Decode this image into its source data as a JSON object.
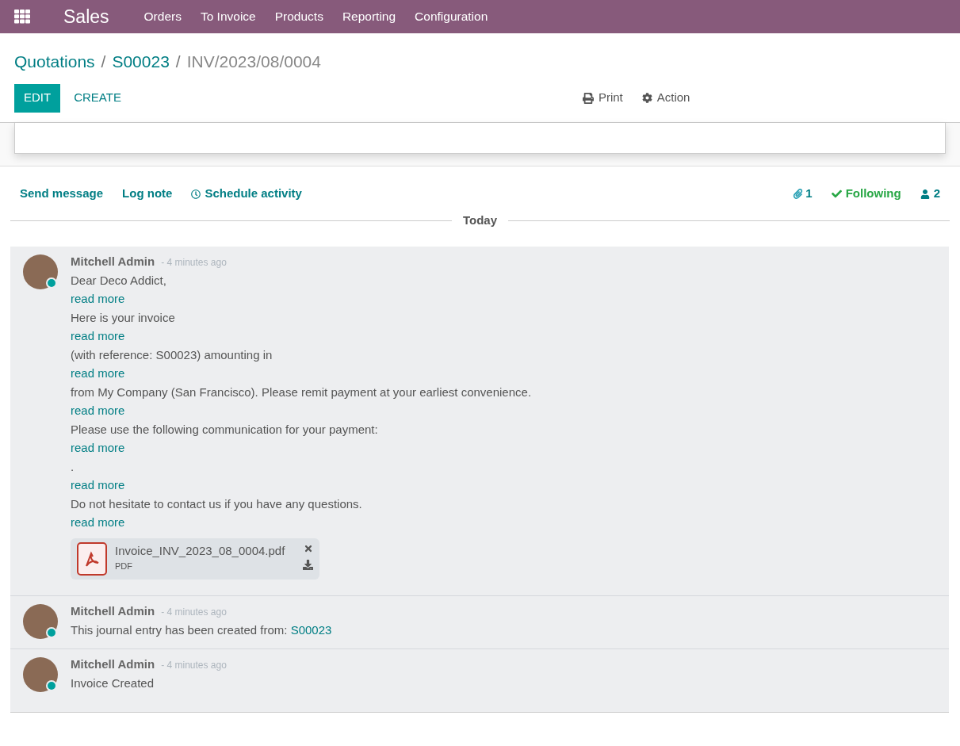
{
  "navbar": {
    "app_name": "Sales",
    "menu": [
      "Orders",
      "To Invoice",
      "Products",
      "Reporting",
      "Configuration"
    ]
  },
  "breadcrumb": {
    "links": [
      "Quotations",
      "S00023"
    ],
    "current": "INV/2023/08/0004",
    "separator": "/"
  },
  "buttons": {
    "edit": "EDIT",
    "create": "CREATE",
    "print": "Print",
    "action": "Action"
  },
  "chatter": {
    "actions": [
      {
        "label": "Send message",
        "kind": "plain"
      },
      {
        "label": "Log note",
        "kind": "plain"
      },
      {
        "label": "Schedule activity",
        "kind": "clock"
      }
    ],
    "attachments_count": "1",
    "following": {
      "label": "Following",
      "on": true
    },
    "followers_count": "2"
  },
  "date_separator": "Today",
  "messages": [
    {
      "author": "Mitchell Admin",
      "time": "- 4 minutes ago",
      "online": true,
      "lines": [
        [
          {
            "kind": "text",
            "text": "Dear Deco Addict,"
          }
        ],
        [
          {
            "kind": "link",
            "text": "read more"
          }
        ],
        [
          {
            "kind": "text",
            "text": "Here is your invoice"
          }
        ],
        [
          {
            "kind": "link",
            "text": "read more"
          }
        ],
        [
          {
            "kind": "text",
            "text": "(with reference: S00023) amounting in"
          }
        ],
        [
          {
            "kind": "link",
            "text": "read more"
          }
        ],
        [
          {
            "kind": "text",
            "text": "from My Company (San Francisco). Please remit payment at your earliest convenience."
          }
        ],
        [
          {
            "kind": "link",
            "text": "read more"
          }
        ],
        [
          {
            "kind": "text",
            "text": "Please use the following communication for your payment:"
          }
        ],
        [
          {
            "kind": "link",
            "text": "read more"
          }
        ],
        [
          {
            "kind": "text",
            "text": "."
          }
        ],
        [
          {
            "kind": "link",
            "text": "read more"
          }
        ],
        [
          {
            "kind": "text",
            "text": "Do not hesitate to contact us if you have any questions."
          }
        ],
        [
          {
            "kind": "link",
            "text": "read more"
          }
        ]
      ],
      "attachments": [
        {
          "name": "Invoice_INV_2023_08_0004.pdf",
          "type": "PDF"
        }
      ]
    },
    {
      "author": "Mitchell Admin",
      "time": "- 4 minutes ago",
      "online": true,
      "lines": [
        [
          {
            "kind": "text",
            "text": "This journal entry has been created from: "
          },
          {
            "kind": "link",
            "text": "S00023"
          }
        ]
      ]
    },
    {
      "author": "Mitchell Admin",
      "time": "- 4 minutes ago",
      "online": true,
      "lines": [
        [
          {
            "kind": "text",
            "text": "Invoice Created"
          }
        ]
      ]
    }
  ]
}
